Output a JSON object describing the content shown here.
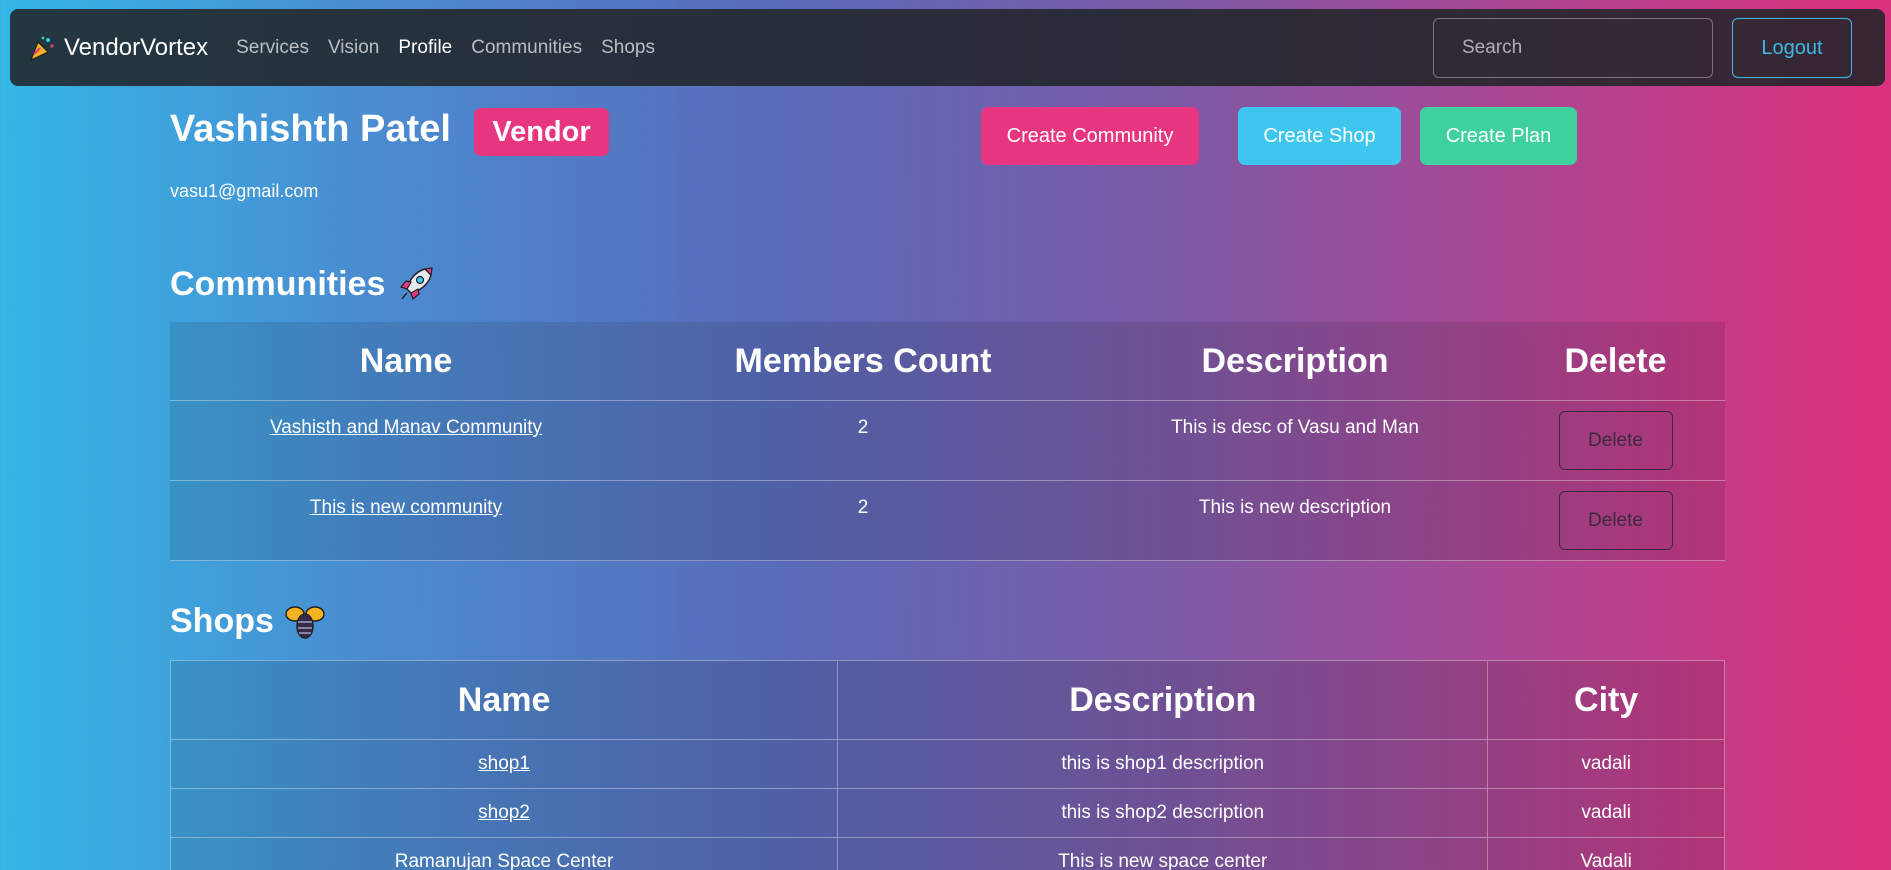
{
  "navbar": {
    "brand": "VendorVortex",
    "links": [
      "Services",
      "Vision",
      "Profile",
      "Communities",
      "Shops"
    ],
    "active": "Profile",
    "search_placeholder": "Search",
    "logout_label": "Logout"
  },
  "profile": {
    "name": "Vashishth Patel",
    "role": "Vendor",
    "email": "vasu1@gmail.com"
  },
  "actions": {
    "create_community": "Create Community",
    "create_shop": "Create Shop",
    "create_plan": "Create Plan"
  },
  "communities": {
    "title": "Communities",
    "icon": "rocket-icon",
    "headers": [
      "Name",
      "Members Count",
      "Description",
      "Delete"
    ],
    "rows": [
      {
        "name": "Vashisth and Manav Community",
        "members": "2",
        "description": "This is desc of Vasu and Man",
        "delete_label": "Delete"
      },
      {
        "name": "This is new community",
        "members": "2",
        "description": "This is new description",
        "delete_label": "Delete"
      }
    ]
  },
  "shops": {
    "title": "Shops",
    "icon": "honeybee-icon",
    "headers": [
      "Name",
      "Description",
      "City"
    ],
    "rows": [
      {
        "name": "shop1",
        "description": "this is shop1 description",
        "city": "vadali"
      },
      {
        "name": "shop2",
        "description": "this is shop2 description",
        "city": "vadali"
      },
      {
        "name": "Ramanujan Space Center",
        "description": "This is new space center",
        "city": "Vadali"
      }
    ]
  },
  "colors": {
    "pink": "#e8357f",
    "cyan": "#3ec6ee",
    "green": "#3fd19d",
    "logout": "#3db8e8"
  }
}
